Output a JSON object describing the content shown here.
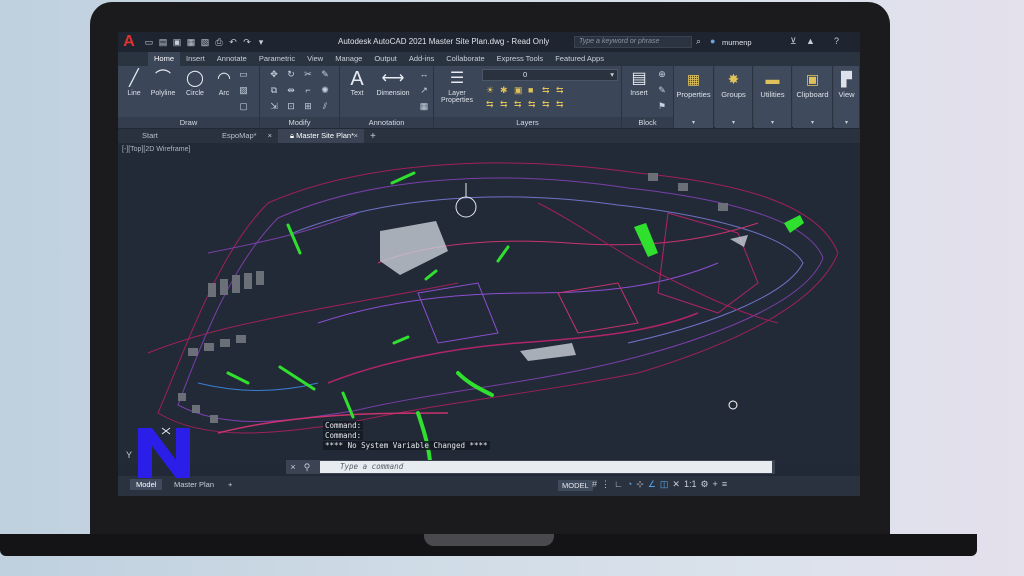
{
  "app": {
    "logo": "A",
    "title": "Autodesk AutoCAD 2021     Master Site Plan.dwg - Read Only",
    "search_placeholder": "Type a keyword or phrase",
    "user": "murnenp"
  },
  "ribbon_tabs": [
    "Home",
    "Insert",
    "Annotate",
    "Parametric",
    "View",
    "Manage",
    "Output",
    "Add-ins",
    "Collaborate",
    "Express Tools",
    "Featured Apps"
  ],
  "panels": {
    "draw": {
      "title": "Draw",
      "tools": [
        "Line",
        "Polyline",
        "Circle",
        "Arc"
      ]
    },
    "modify": {
      "title": "Modify"
    },
    "annotation": {
      "title": "Annotation",
      "tools": [
        "Text",
        "Dimension"
      ]
    },
    "layers": {
      "title": "Layers",
      "tool": "Layer Properties",
      "current_layer": "0"
    },
    "block": {
      "title": "Block",
      "tool": "Insert"
    },
    "right_tools": [
      "Properties",
      "Groups",
      "Utilities",
      "Clipboard",
      "View"
    ]
  },
  "file_tabs": [
    "Start",
    "EspoMap*",
    "Master Site Plan*"
  ],
  "viewport_label": "[-][Top][2D Wireframe]",
  "command": {
    "history": [
      "Command:",
      "Command:",
      "**** No System Variable Changed ****"
    ],
    "placeholder": "Type a command"
  },
  "status": {
    "layouts": [
      "Model",
      "Master Plan"
    ],
    "model_button": "MODEL",
    "scale": "1:1"
  },
  "colors": {
    "background": "#222a37",
    "ribbon": "#3b4658",
    "accent_blue": "#5aa8f0",
    "logo_red": "#e0322f",
    "overlay_logo": "#2b1ee8"
  }
}
